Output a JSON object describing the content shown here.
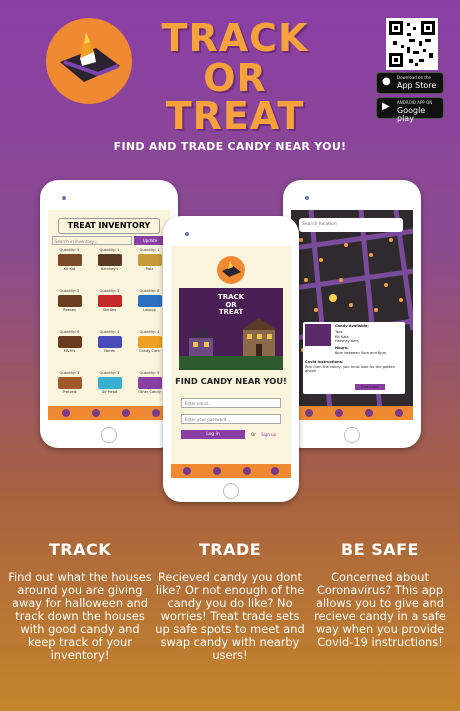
{
  "header": {
    "title_line1": "TRACK",
    "title_line2": "OR",
    "title_line3": "TREAT",
    "tagline": "FIND AND TRADE CANDY NEAR YOU!"
  },
  "stores": {
    "appstore_small": "Download on the",
    "appstore_large": "App Store",
    "gplay_small": "ANDROID APP ON",
    "gplay_large": "Google play"
  },
  "inventory_screen": {
    "title": "TREAT INVENTORY",
    "search_placeholder": "Search in inventory...",
    "update_label": "Update",
    "items": [
      {
        "qty": "Quantity: 5",
        "name": "Kit Kat",
        "color": "#7b4a2a"
      },
      {
        "qty": "Quantity: 1",
        "name": "Hershey's",
        "color": "#5a3a22"
      },
      {
        "qty": "Quantity: 1",
        "name": "Twix",
        "color": "#c79a3a"
      },
      {
        "qty": "Quantity: 2",
        "name": "Reeses",
        "color": "#6b3d20"
      },
      {
        "qty": "Quantity: 3",
        "name": "Skittles",
        "color": "#c22a2a"
      },
      {
        "qty": "Quantity: 8",
        "name": "Lolipop",
        "color": "#2a6fc2"
      },
      {
        "qty": "Quantity: 6",
        "name": "M&M's",
        "color": "#6b3a1e"
      },
      {
        "qty": "Quantity: 4",
        "name": "Nerds",
        "color": "#4a4ab8"
      },
      {
        "qty": "Quantity: 4",
        "name": "Candy Corn",
        "color": "#f0a020"
      },
      {
        "qty": "Quantity: 3",
        "name": "Pretzels",
        "color": "#a05a2a"
      },
      {
        "qty": "Quantity: 3",
        "name": "Air Head",
        "color": "#3ab0d0"
      },
      {
        "qty": "Quantity: 9",
        "name": "Other Candy",
        "color": "#8a3fa5"
      }
    ]
  },
  "map_screen": {
    "search_placeholder": "Search location",
    "card_available": "Candy Available:",
    "card_items": "Twix\nKit Kats\nHershey bars",
    "card_hours_label": "Hours:",
    "card_hours": "6pm between 5pm and 8pm",
    "card_instructions_label": "Covid Instructions:",
    "card_instructions": "Pick from the candy, you must look for the golden ghost!",
    "directions_label": "Directions"
  },
  "login_screen": {
    "art_title_line1": "TRACK",
    "art_title_line2": "OR",
    "art_title_line3": "TREAT",
    "tagline": "FIND CANDY NEAR YOU!",
    "email_placeholder": "Enter email...",
    "password_placeholder": "Enter your password...",
    "login_label": "Log in",
    "or_label": "Or",
    "signup_label": "Sign up"
  },
  "features": [
    {
      "title": "TRACK",
      "text": "Find out what the houses around you are giving away for halloween and track down the houses with good candy and keep track of your inventory!"
    },
    {
      "title": "TRADE",
      "text": "Recieved candy you dont like? Or not enough of the candy you do like? No worries! Treat trade sets up safe spots to meet and swap candy with nearby users!"
    },
    {
      "title": "BE SAFE",
      "text": "Concerned about Coronavirus? This app allows you to give and recieve candy in a safe way when you provide Covid-19 instructions!"
    }
  ],
  "colors": {
    "purple": "#8a3fa5",
    "orange": "#f08a32",
    "title_orange": "#f5a23c"
  }
}
